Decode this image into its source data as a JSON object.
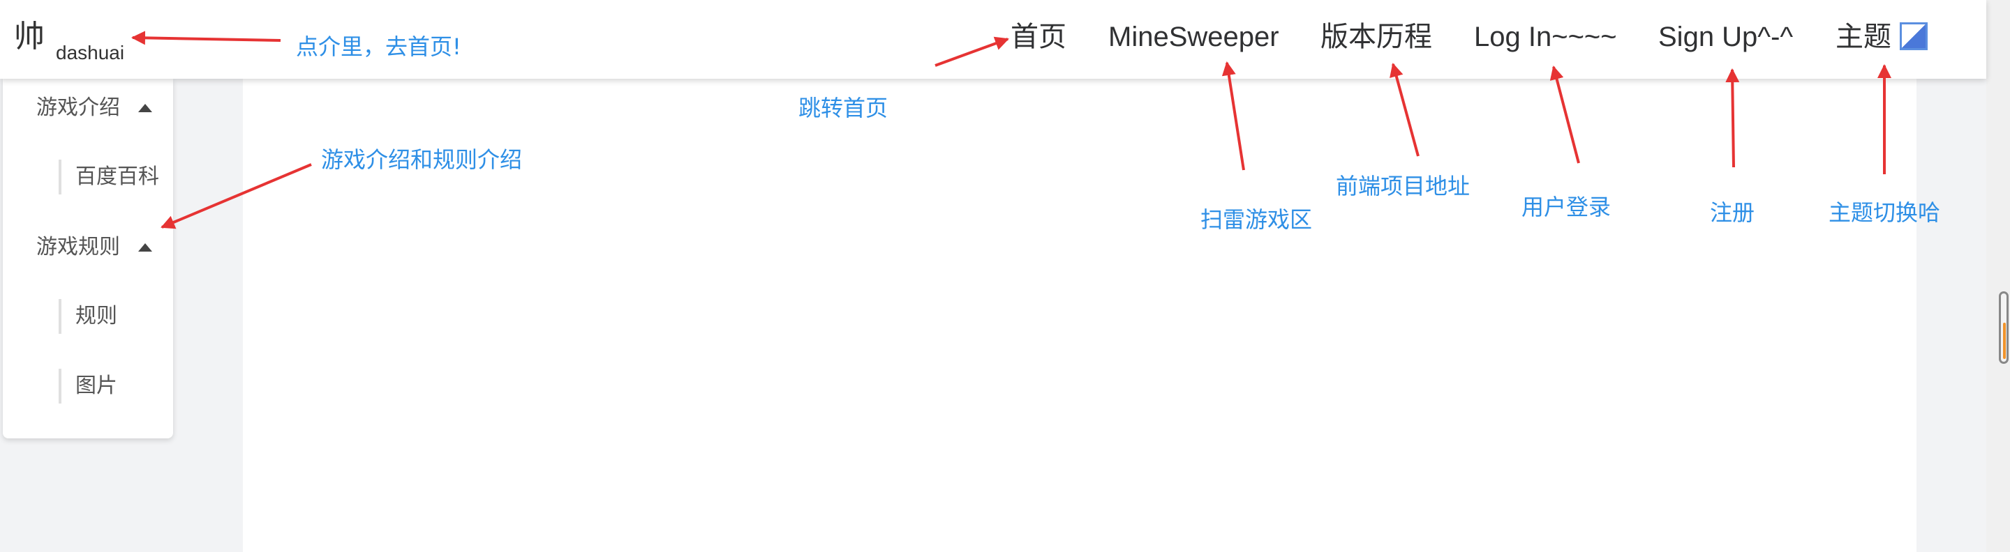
{
  "header": {
    "logo_char": "帅",
    "logo_name": "dashuai",
    "nav": [
      {
        "label": "首页"
      },
      {
        "label": "MineSweeper"
      },
      {
        "label": "版本历程"
      },
      {
        "label": "Log In~~~~"
      },
      {
        "label": "Sign Up^-^"
      },
      {
        "label": "主题"
      }
    ]
  },
  "sidebar": {
    "groups": [
      {
        "title": "游戏介绍",
        "items": [
          "百度百科"
        ]
      },
      {
        "title": "游戏规则",
        "items": [
          "规则",
          "图片"
        ]
      }
    ]
  },
  "annotations": [
    {
      "text": "点介里，去首页!"
    },
    {
      "text": "跳转首页"
    },
    {
      "text": "游戏介绍和规则介绍"
    },
    {
      "text": "扫雷游戏区"
    },
    {
      "text": "前端项目地址"
    },
    {
      "text": "用户登录"
    },
    {
      "text": "注册"
    },
    {
      "text": "主题切换哈"
    }
  ],
  "colors": {
    "annotation": "#2e8fe6",
    "arrow": "#e63333",
    "page_bg": "#f2f3f5",
    "content_bg": "#ffffff",
    "scroll_indicator": "#f0932b"
  },
  "icons": {
    "caret": "caret-up-icon",
    "theme": "theme-toggle-icon"
  }
}
